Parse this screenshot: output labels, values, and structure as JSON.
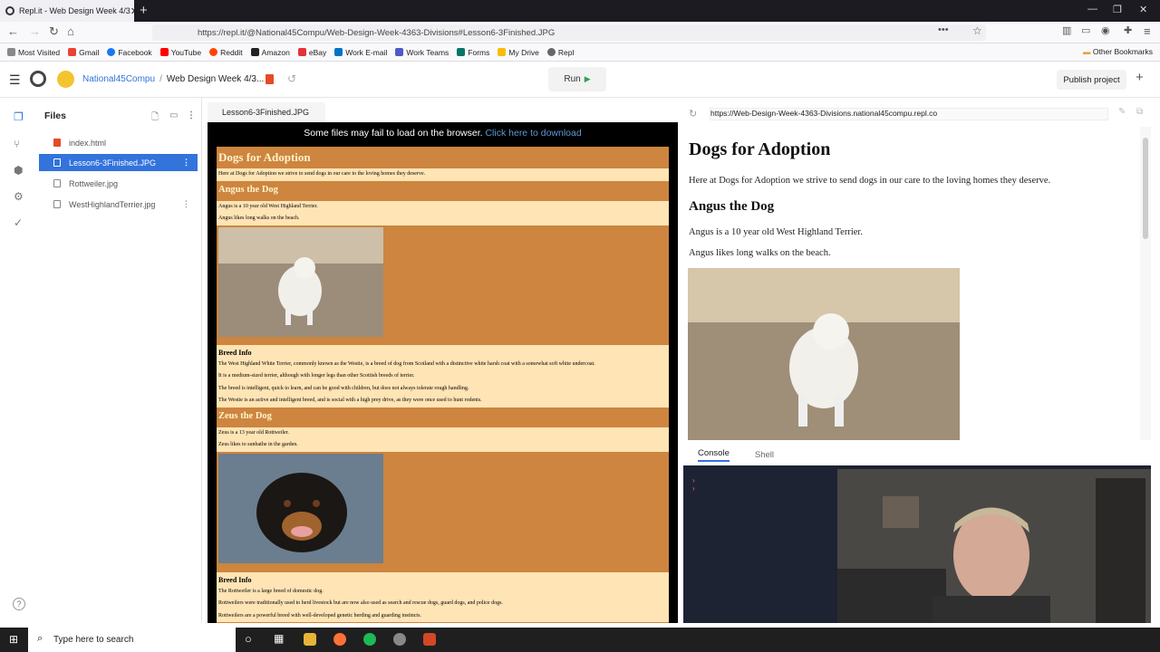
{
  "browser": {
    "tab_title": "Repl.it - Web Design Week 4/3",
    "url": "https://repl.it/@National45Compu/Web-Design-Week-4363-Divisions#Lesson6-3Finished.JPG",
    "bookmarks": [
      "Most Visited",
      "Gmail",
      "Facebook",
      "YouTube",
      "Reddit",
      "Amazon",
      "eBay",
      "Work E-mail",
      "Work Teams",
      "Forms",
      "My Drive",
      "Repl"
    ],
    "other_bookmarks": "Other Bookmarks"
  },
  "repl": {
    "user": "National45Compu",
    "project": "Web Design Week 4/3...",
    "run_label": "Run",
    "publish_label": "Publish project"
  },
  "files": {
    "title": "Files",
    "items": [
      "index.html",
      "Lesson6-3Finished.JPG",
      "Rottweiler.jpg",
      "WestHighlandTerrier.jpg"
    ]
  },
  "editor": {
    "tab": "Lesson6-3Finished.JPG",
    "fail_msg": "Some files may fail to load on the browser.",
    "download_link": "Click here to download",
    "screenshot": {
      "h1": "Dogs for Adoption",
      "intro": "Here at Dogs for Adoption we strive to send dogs in our care to the loving homes they deserve.",
      "angus_title": "Angus the Dog",
      "angus_p1": "Angus is a 10 year old West Highland Terrier.",
      "angus_p2": "Angus likes long walks on the beach.",
      "breed_title": "Breed Info",
      "westie_1": "The West Highland White Terrier, commonly known as the Westie, is a breed of dog from Scotland with a distinctive white harsh coat with a somewhat soft white undercoat.",
      "westie_2": "It is a medium-sized terrier, although with longer legs than other Scottish breeds of terrier.",
      "westie_3": "The breed is intelligent, quick to learn, and can be good with children, but does not always tolerate rough handling.",
      "westie_4": "The Westie is an active and intelligent breed, and is social with a high prey drive, as they were once used to hunt rodents.",
      "zeus_title": "Zeus the Dog",
      "zeus_p1": "Zeus is a 13 year old Rottweiler.",
      "zeus_p2": "Zeus likes to sunbathe in the garden.",
      "rott_1": "The Rottweiler is a large breed of domestic dog.",
      "rott_2": "Rottweilers were traditionally used to herd livestock but are now also used as search and rescue dogs, guard dogs, and police dogs.",
      "rott_3": "Rottweilers are a powerful breed with well-developed genetic herding and guarding instincts."
    }
  },
  "preview": {
    "url": "https://Web-Design-Week-4363-Divisions.national45compu.repl.co",
    "h1": "Dogs for Adoption",
    "intro": "Here at Dogs for Adoption we strive to send dogs in our care to the loving homes they deserve.",
    "angus_title": "Angus the Dog",
    "angus_p1": "Angus is a 10 year old West Highland Terrier.",
    "angus_p2": "Angus likes long walks on the beach."
  },
  "console": {
    "tabs": [
      "Console",
      "Shell"
    ]
  },
  "taskbar": {
    "search_placeholder": "Type here to search"
  },
  "colors": {
    "accent": "#3273dc",
    "page_bg": "#cd853f",
    "page_para": "#ffe4b5",
    "console_bg": "#1d2333"
  }
}
